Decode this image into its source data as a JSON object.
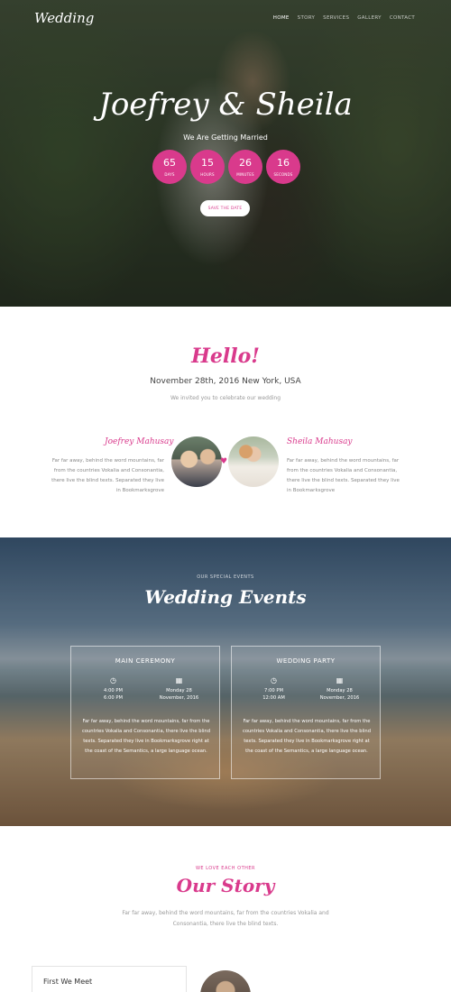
{
  "header": {
    "logo": "Wedding",
    "nav": [
      {
        "label": "HOME",
        "active": true
      },
      {
        "label": "STORY",
        "active": false
      },
      {
        "label": "SERVICES",
        "active": false
      },
      {
        "label": "GALLERY",
        "active": false
      },
      {
        "label": "CONTACT",
        "active": false
      }
    ]
  },
  "hero": {
    "title": "Joefrey & Sheila",
    "tagline": "We Are Getting Married",
    "countdown": [
      {
        "value": "65",
        "unit": "DAYS"
      },
      {
        "value": "15",
        "unit": "HOURS"
      },
      {
        "value": "26",
        "unit": "MINUTES"
      },
      {
        "value": "16",
        "unit": "SECONDS"
      }
    ],
    "cta": "SAVE THE DATE"
  },
  "hello": {
    "title": "Hello!",
    "date": "November 28th, 2016 New York, USA",
    "subtitle": "We invited you to celebrate our wedding",
    "groom": {
      "name": "Joefrey Mahusay",
      "bio": "Far far away, behind the word mountains, far from the countries Vokalia and Consonantia, there live the blind texts. Separated they live in Bookmarksgrove"
    },
    "bride": {
      "name": "Sheila Mahusay",
      "bio": "Far far away, behind the word mountains, far from the countries Vokalia and Consonantia, there live the blind texts. Separated they live in Bookmarksgrove"
    }
  },
  "events": {
    "kicker": "OUR SPECIAL EVENTS",
    "title": "Wedding Events",
    "cards": [
      {
        "title": "MAIN CEREMONY",
        "time_line1": "4:00 PM",
        "time_line2": "6:00 PM",
        "date_line1": "Monday 28",
        "date_line2": "November, 2016",
        "desc": "Far far away, behind the word mountains, far from the countries Vokalia and Consonantia, there live the blind texts. Separated they live in Bookmarksgrove right at the coast of the Semantics, a large language ocean."
      },
      {
        "title": "WEDDING PARTY",
        "time_line1": "7:00 PM",
        "time_line2": "12:00 AM",
        "date_line1": "Monday 28",
        "date_line2": "November, 2016",
        "desc": "Far far away, behind the word mountains, far from the countries Vokalia and Consonantia, there live the blind texts. Separated they live in Bookmarksgrove right at the coast of the Semantics, a large language ocean."
      }
    ]
  },
  "story": {
    "kicker": "WE LOVE EACH OTHER",
    "title": "Our Story",
    "text": "Far far away, behind the word mountains, far from the countries Vokalia and Consonantia, there live the blind texts.",
    "first_item": "First We Meet"
  },
  "colors": {
    "accent": "#d93a8c"
  }
}
